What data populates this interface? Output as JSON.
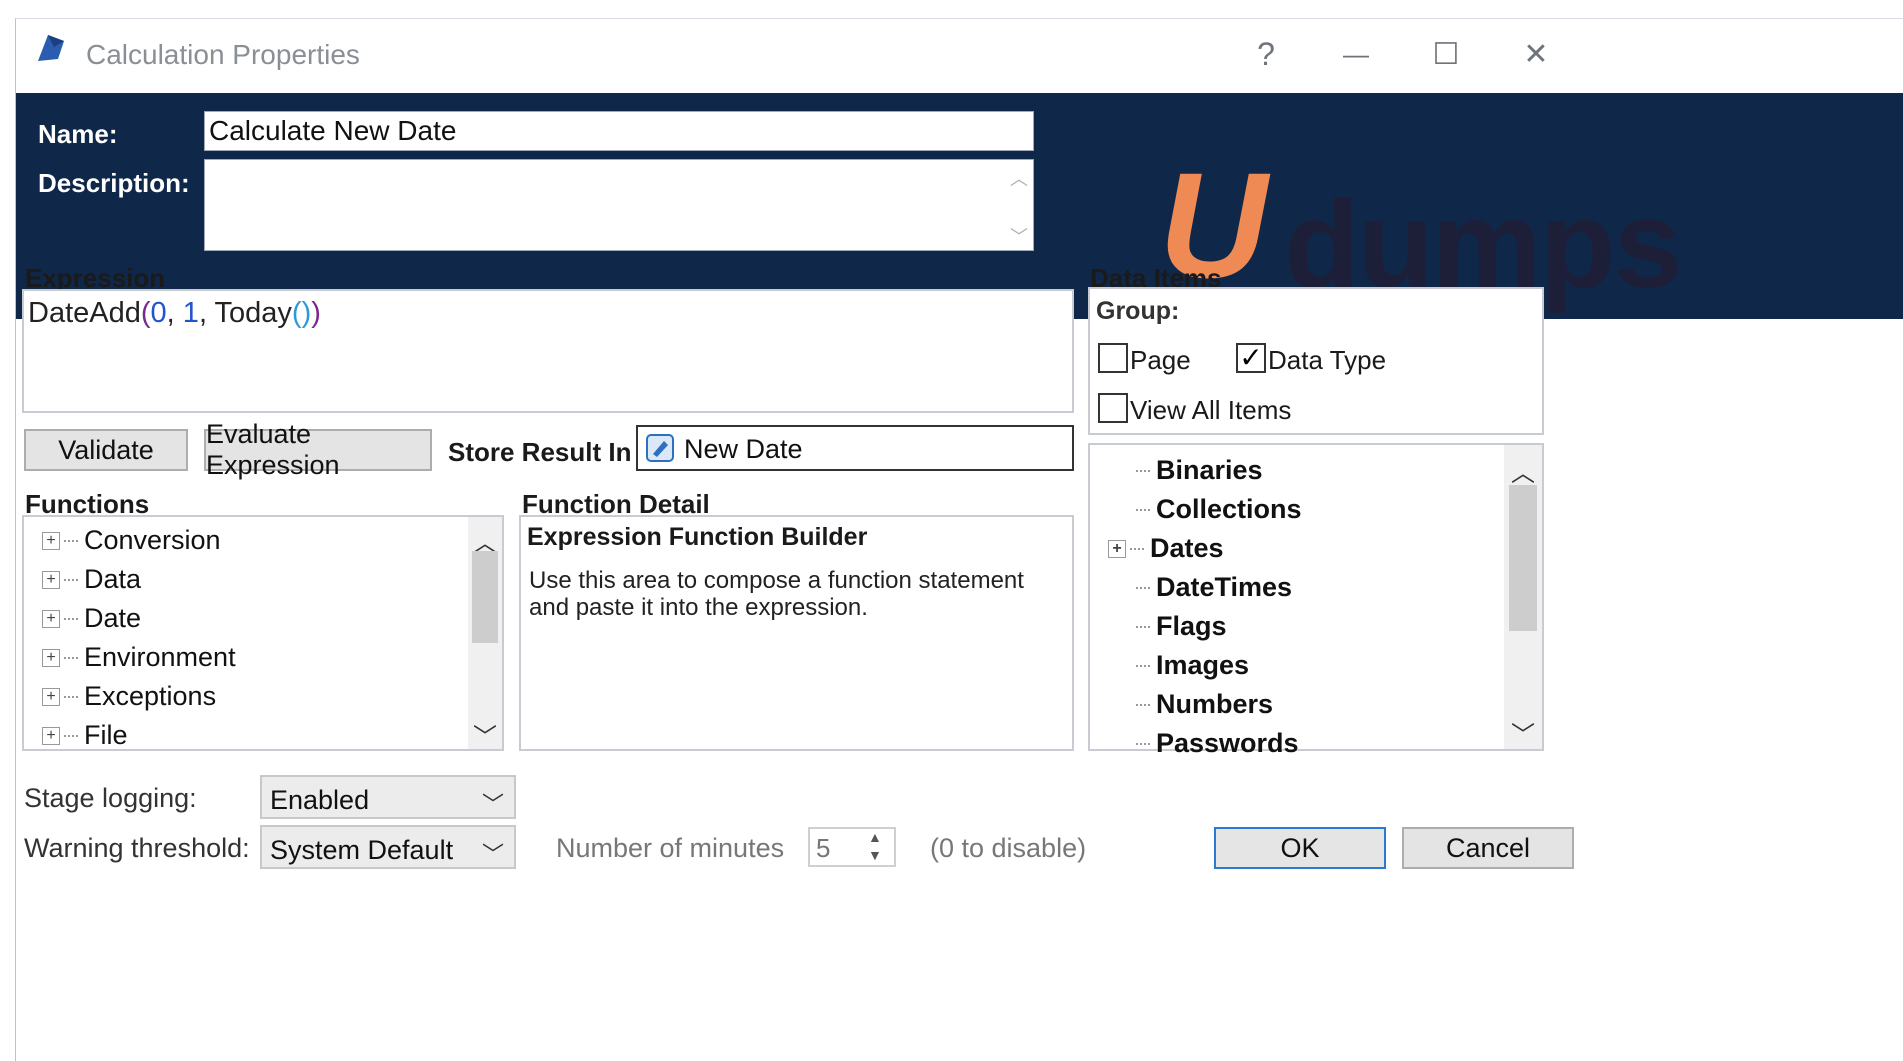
{
  "window": {
    "title": "Calculation Properties",
    "help_glyph": "?",
    "minimize_glyph": "—",
    "maximize_glyph": "☐",
    "close_glyph": "✕"
  },
  "header": {
    "name_label": "Name:",
    "name_value": "Calculate New Date",
    "description_label": "Description:",
    "description_value": ""
  },
  "watermark": {
    "brand_text": "dumps"
  },
  "expression": {
    "label": "Expression",
    "parts": [
      "DateAdd",
      "(",
      "0",
      ", ",
      "1",
      ", ",
      "Today",
      "()",
      ")"
    ],
    "validate_label": "Validate",
    "evaluate_label": "Evaluate Expression",
    "store_label": "Store Result In",
    "store_value": "New Date"
  },
  "functions": {
    "label": "Functions",
    "items": [
      "Conversion",
      "Data",
      "Date",
      "Environment",
      "Exceptions",
      "File"
    ]
  },
  "function_detail": {
    "label": "Function Detail",
    "heading": "Expression Function Builder",
    "body": "Use this area to compose a function statement and paste it into the expression."
  },
  "data_items": {
    "label": "Data Items",
    "group_label": "Group:",
    "page_label": "Page",
    "page_checked": false,
    "data_type_label": "Data Type",
    "data_type_checked": true,
    "view_all_label": "View All Items",
    "view_all_checked": false,
    "items": [
      "Binaries",
      "Collections",
      "Dates",
      "DateTimes",
      "Flags",
      "Images",
      "Numbers",
      "Passwords"
    ]
  },
  "footer": {
    "stage_logging_label": "Stage logging:",
    "stage_logging_value": "Enabled",
    "warning_label": "Warning threshold:",
    "warning_value": "System Default",
    "minutes_label": "Number of minutes",
    "minutes_value": "5",
    "disable_hint": "(0 to disable)",
    "ok_label": "OK",
    "cancel_label": "Cancel"
  },
  "colors": {
    "header_bg": "#0f2748",
    "expr_function": "#222222",
    "expr_paren": "#7a2a8f",
    "expr_number": "#2255cc",
    "expr_call_paren": "#2a9ad8",
    "ok_border": "#2b79d0"
  }
}
